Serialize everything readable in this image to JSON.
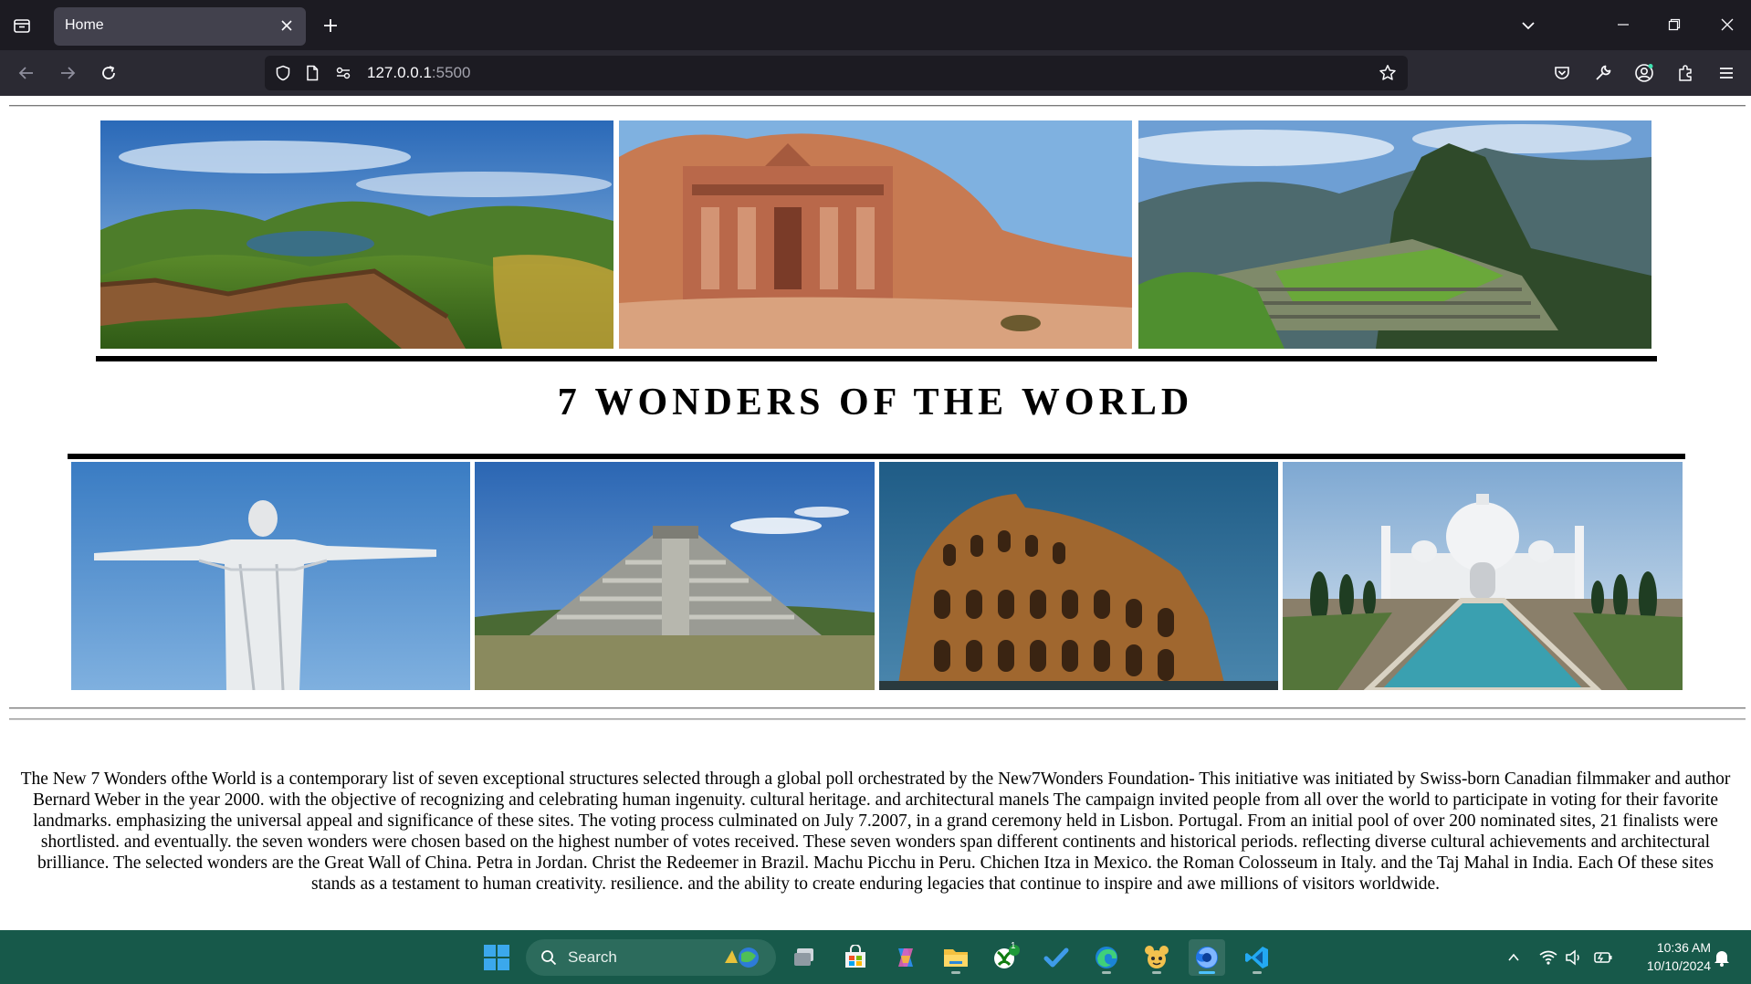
{
  "browser": {
    "tab": {
      "title": "Home"
    },
    "url": {
      "host": "127.0.0.1",
      "port": ":5500"
    }
  },
  "page": {
    "heading": "7 WONDERS OF THE WORLD",
    "paragraph": "The New 7 Wonders ofthe World is a contemporary list of seven exceptional structures selected through a global poll orchestrated by the New7Wonders Foundation- This initiative was initiated by Swiss-born Canadian filmmaker and author Bernard Weber in the year 2000. with the objective of recognizing and celebrating human ingenuity. cultural heritage. and architectural manels The campaign invited people from all over the world to participate in voting for their favorite landmarks. emphasizing the universal appeal and significance of these sites. The voting process culminated on July 7.2007, in a grand ceremony held in Lisbon. Portugal. From an initial pool of over 200 nominated sites, 21 finalists were shortlisted. and eventually. the seven wonders were chosen based on the highest number of votes received. These seven wonders span different continents and historical periods. reflecting diverse cultural achievements and architectural brilliance. The selected wonders are the Great Wall of China. Petra in Jordan. Christ the Redeemer in Brazil. Machu Picchu in Peru. Chichen Itza in Mexico. the Roman Colosseum in Italy. and the Taj Mahal in India. Each Of these sites stands as a testament to human creativity. resilience. and the ability to create enduring legacies that continue to inspire and awe millions of visitors worldwide."
  },
  "taskbar": {
    "search_label": "Search",
    "time": "10:36 AM",
    "date": "10/10/2024",
    "xbox_badge": "1"
  }
}
